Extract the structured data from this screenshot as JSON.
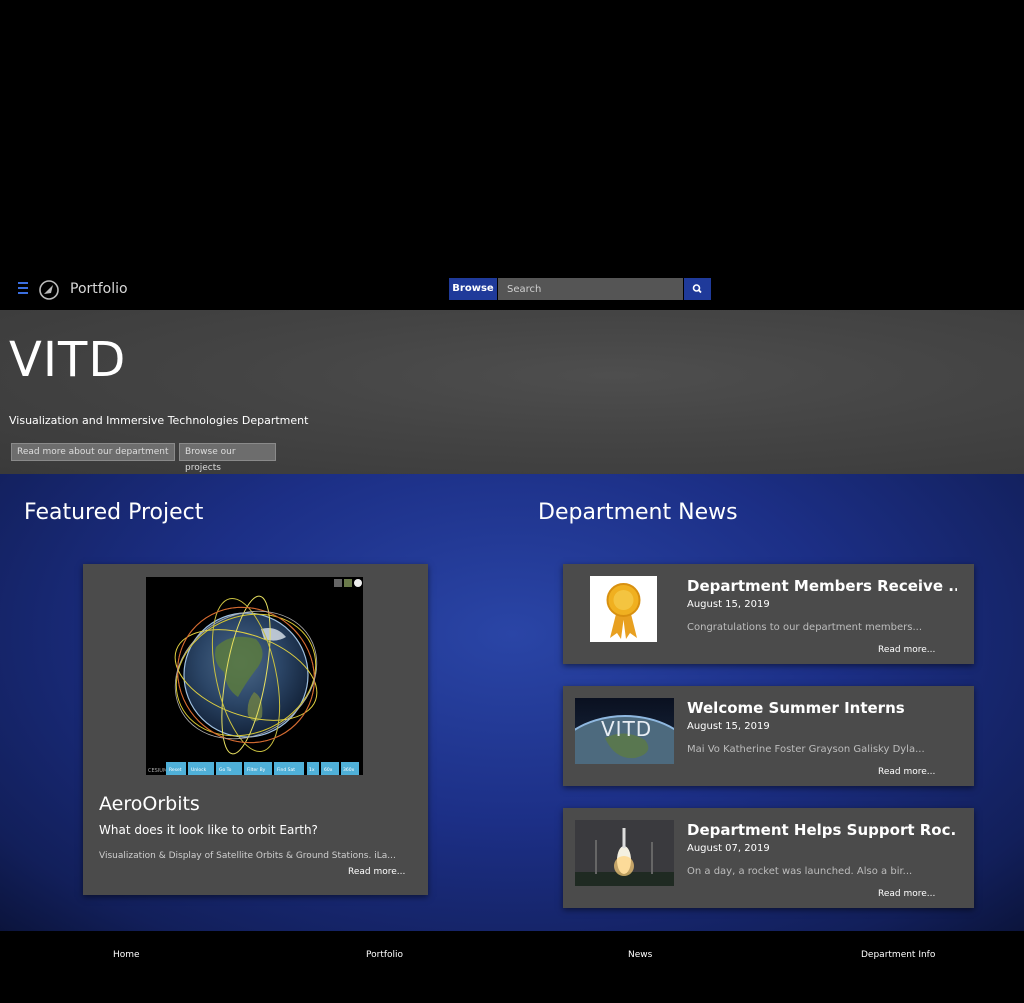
{
  "nav": {
    "brand": "Portfolio",
    "browse_label": "Browse",
    "search_placeholder": "Search"
  },
  "hero": {
    "title": "VITD",
    "subtitle": "Visualization and Immersive Technologies Department",
    "btn_about": "Read more about our department",
    "btn_projects": "Browse our projects"
  },
  "featured": {
    "heading": "Featured Project",
    "title": "AeroOrbits",
    "subtitle": "What does it look like to orbit Earth?",
    "description": "Visualization & Display of Satellite Orbits & Ground Stations. iLa...",
    "read_more": "Read more...",
    "toolbar_buttons": [
      "Reset",
      "Unlock",
      "Go To",
      "Filter By",
      "Find Sat",
      "1x",
      "60x",
      "360x"
    ],
    "logo_text": "CESIUM"
  },
  "news": {
    "heading": "Department News",
    "items": [
      {
        "title": "Department Members Receive ...",
        "date": "August 15, 2019",
        "excerpt": "Congratulations to our department members...",
        "read_more": "Read more..."
      },
      {
        "title": "Welcome Summer Interns",
        "date": "August 15, 2019",
        "excerpt": "Mai Vo Katherine Foster Grayson Galisky Dyla...",
        "read_more": "Read more...",
        "thumb_text": "VITD"
      },
      {
        "title": "Department Helps Support Roc...",
        "date": "August 07, 2019",
        "excerpt": "On a day, a rocket was launched. Also a bir...",
        "read_more": "Read more..."
      }
    ]
  },
  "footer": {
    "links": [
      "Home",
      "Portfolio",
      "News",
      "Department Info"
    ]
  },
  "colors": {
    "accent": "#1f3a9a",
    "main_bg": "#1c2f86",
    "card_bg": "#4b4b4b",
    "hero_bg": "#444444"
  }
}
